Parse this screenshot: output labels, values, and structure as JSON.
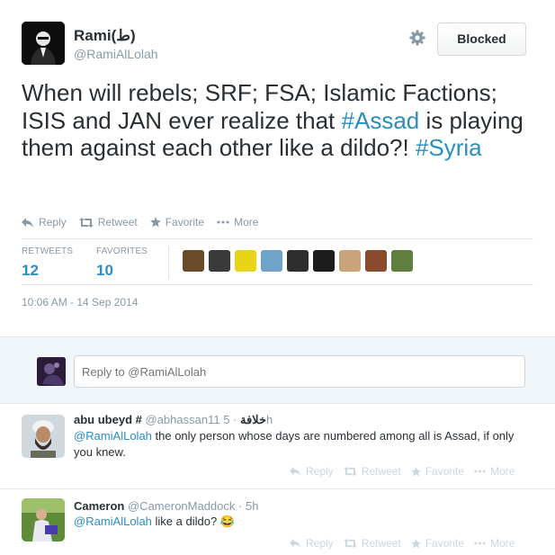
{
  "tweet": {
    "author_name": "Rami(ط)",
    "author_handle": "@RamiAlLolah",
    "blocked_label": "Blocked",
    "text_before": "When will rebels; SRF; FSA; Islamic Factions; ISIS and JAN ever realize that ",
    "hashtag_assad": "#Assad",
    "text_middle": " is playing them against each other like a dildo?! ",
    "hashtag_syria": "#Syria",
    "actions": {
      "reply": "Reply",
      "retweet": "Retweet",
      "favorite": "Favorite",
      "more": "More"
    },
    "stats": {
      "retweets_label": "RETWEETS",
      "retweets_value": "12",
      "favorites_label": "FAVORITES",
      "favorites_value": "10"
    },
    "favoriter_avatar_colors": [
      "#6b4a2a",
      "#3a3a3a",
      "#e8d51a",
      "#6fa3c7",
      "#2e2e2e",
      "#1c1c1c",
      "#c9a37a",
      "#8a4a2e",
      "#5f7f3f"
    ],
    "timestamp": "10:06 AM - 14 Sep 2014"
  },
  "reply_box": {
    "placeholder": "Reply to @RamiAlLolah"
  },
  "replies": [
    {
      "name": "abu ubeyd #",
      "handle": "@abhassan11",
      "suffix": "خلافة",
      "time": "· 5h",
      "mention": "@RamiAlLolah",
      "text": " the only person whose days are numbered among all is Assad, if only you knew.",
      "actions": {
        "reply": "Reply",
        "retweet": "Retweet",
        "favorite": "Favorite",
        "more": "More"
      }
    },
    {
      "name": "Cameron",
      "handle": "@CameronMaddock",
      "time": "· 5h",
      "mention": "@RamiAlLolah",
      "text": " like a dildo? 😂",
      "actions": {
        "reply": "Reply",
        "retweet": "Retweet",
        "favorite": "Favorite",
        "more": "More"
      }
    }
  ],
  "colors": {
    "link": "#2a8ebf",
    "muted": "#8899a6",
    "reply_bg": "#f0f6fa"
  }
}
